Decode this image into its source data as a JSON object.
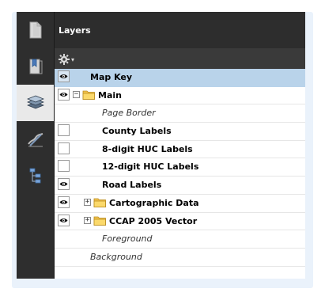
{
  "header": {
    "title": "Layers"
  },
  "toolbar": {
    "options_icon": "gear-icon",
    "options_arrow": "▾"
  },
  "nav": {
    "items": [
      {
        "icon": "page-thumbnails-icon"
      },
      {
        "icon": "bookmarks-icon"
      },
      {
        "icon": "layers-icon",
        "active": true
      },
      {
        "icon": "signatures-icon"
      },
      {
        "icon": "model-tree-icon"
      }
    ]
  },
  "layers": [
    {
      "label": "Map Key",
      "visible": true,
      "selected": true,
      "indent": 0,
      "style": "bold"
    },
    {
      "label": "Main",
      "visible": true,
      "expander": "−",
      "folder": true,
      "indent": 0,
      "style": "bold"
    },
    {
      "label": "Page Border",
      "visible": null,
      "indent": 2,
      "style": "italic"
    },
    {
      "label": "County Labels",
      "visible": false,
      "indent": 2,
      "style": "bold"
    },
    {
      "label": "8-digit HUC Labels",
      "visible": false,
      "indent": 2,
      "style": "bold"
    },
    {
      "label": "12-digit HUC Labels",
      "visible": false,
      "indent": 2,
      "style": "bold"
    },
    {
      "label": "Road Labels",
      "visible": true,
      "indent": 2,
      "style": "bold"
    },
    {
      "label": "Cartographic Data",
      "visible": true,
      "expander": "+",
      "folder": true,
      "indent": 1,
      "style": "bold"
    },
    {
      "label": "CCAP 2005 Vector",
      "visible": true,
      "expander": "+",
      "folder": true,
      "indent": 1,
      "style": "bold"
    },
    {
      "label": "Foreground",
      "visible": null,
      "indent": 2,
      "style": "italic"
    },
    {
      "label": "Background",
      "visible": null,
      "indent": 1,
      "style": "italic"
    }
  ]
}
